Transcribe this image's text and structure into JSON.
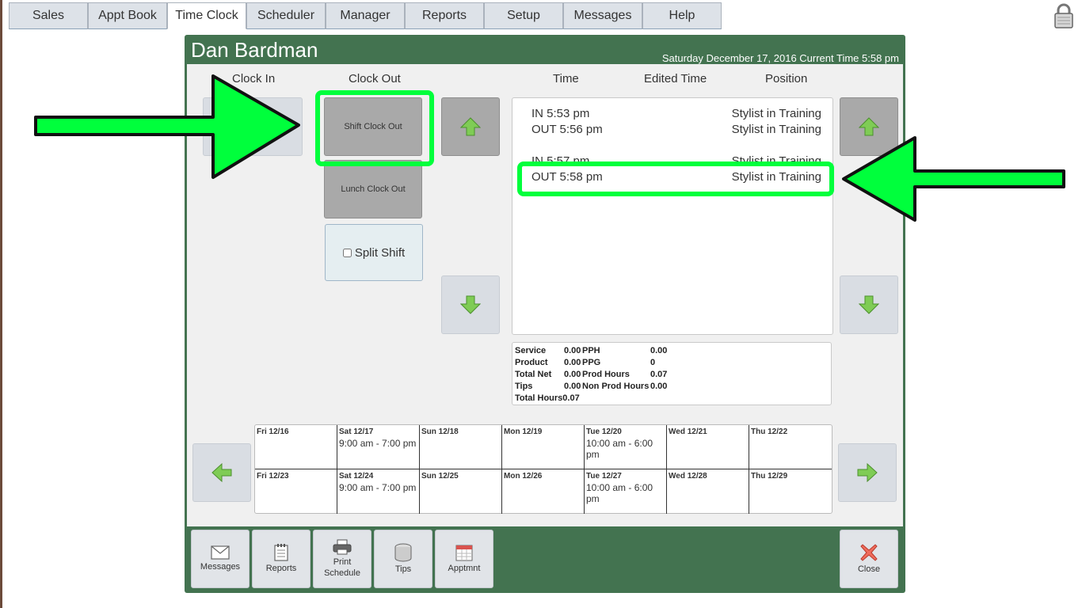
{
  "tabs": [
    {
      "label": "Sales"
    },
    {
      "label": "Appt Book"
    },
    {
      "label": "Time Clock"
    },
    {
      "label": "Scheduler"
    },
    {
      "label": "Manager"
    },
    {
      "label": "Reports"
    },
    {
      "label": "Setup"
    },
    {
      "label": "Messages"
    },
    {
      "label": "Help"
    }
  ],
  "active_tab": "Time Clock",
  "employee": {
    "name": "Dan Bardman"
  },
  "date_line": "Saturday December 17, 2016 Current Time 5:58 pm",
  "columns": {
    "clock_in": "Clock In",
    "clock_out": "Clock Out",
    "time": "Time",
    "edited_time": "Edited Time",
    "position": "Position"
  },
  "buttons": {
    "shift_clock_out": "Shift Clock Out",
    "lunch_clock_out": "Lunch Clock Out",
    "split_shift": "Split Shift"
  },
  "punches": [
    {
      "time": "IN 5:53 pm",
      "position": "Stylist in Training"
    },
    {
      "time": "OUT 5:56 pm",
      "position": "Stylist in Training"
    },
    {
      "time": "IN 5:57 pm",
      "position": "Stylist in Training"
    },
    {
      "time": "OUT 5:58 pm",
      "position": "Stylist in Training"
    }
  ],
  "stats": {
    "service_label": "Service",
    "service": "0.00",
    "product_label": "Product",
    "product": "0.00",
    "total_net_label": "Total Net",
    "total_net": "0.00",
    "tips_label": "Tips",
    "tips": "0.00",
    "total_hours_label": "Total Hours",
    "total_hours": "0.07",
    "pph_label": "PPH",
    "pph": "0.00",
    "ppg_label": "PPG",
    "ppg": "0",
    "prod_hours_label": "Prod Hours",
    "prod_hours": "0.07",
    "non_prod_hours_label": "Non Prod Hours",
    "non_prod_hours": "0.00"
  },
  "schedule": [
    {
      "day": "Fri 12/16",
      "hours": ""
    },
    {
      "day": "Sat 12/17",
      "hours": "9:00 am - 7:00 pm"
    },
    {
      "day": "Sun 12/18",
      "hours": ""
    },
    {
      "day": "Mon 12/19",
      "hours": ""
    },
    {
      "day": "Tue 12/20",
      "hours": "10:00 am - 6:00 pm"
    },
    {
      "day": "Wed 12/21",
      "hours": ""
    },
    {
      "day": "Thu 12/22",
      "hours": ""
    },
    {
      "day": "Fri 12/23",
      "hours": ""
    },
    {
      "day": "Sat 12/24",
      "hours": "9:00 am - 7:00 pm"
    },
    {
      "day": "Sun 12/25",
      "hours": ""
    },
    {
      "day": "Mon 12/26",
      "hours": ""
    },
    {
      "day": "Tue 12/27",
      "hours": "10:00 am - 6:00 pm"
    },
    {
      "day": "Wed 12/28",
      "hours": ""
    },
    {
      "day": "Thu 12/29",
      "hours": ""
    }
  ],
  "toolbar": {
    "messages": "Messages",
    "reports": "Reports",
    "print_schedule_1": "Print",
    "print_schedule_2": "Schedule",
    "tips": "Tips",
    "apptmnt": "Apptmnt",
    "close": "Close"
  },
  "icons": {
    "lock": "lock-icon",
    "up": "arrow-up-icon",
    "down": "arrow-down-icon",
    "left": "arrow-left-icon",
    "right": "arrow-right-icon"
  },
  "colors": {
    "panel_green": "#437350",
    "highlight_green": "#00ff3c",
    "nav_arrow_green": "#6cc04a"
  }
}
